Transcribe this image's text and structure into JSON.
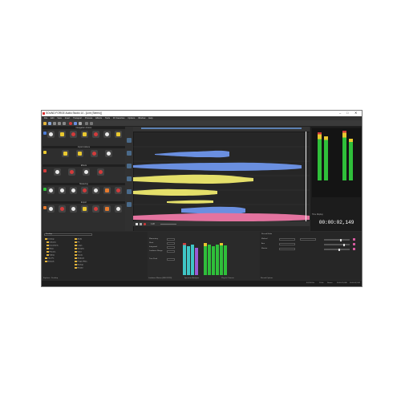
{
  "window": {
    "title": "SOUND FORGE Audio Studio 14 - [Live (Stereo)]",
    "controls": {
      "minimize": "–",
      "maximize": "□",
      "close": "✕"
    }
  },
  "menu": [
    "File",
    "Edit",
    "View",
    "Insert",
    "Transport",
    "Process",
    "Effects",
    "Tools",
    "FX Favorites",
    "Options",
    "Window",
    "Help"
  ],
  "left_panel": {
    "sections": [
      "Navigation Actions",
      "Import Actions",
      "Effects",
      "Mastering",
      "Export"
    ]
  },
  "transport": {
    "zoom": "1:28"
  },
  "right_panel": {
    "header": "Time Display",
    "timecode": "00:00:02,149"
  },
  "bottom": {
    "explorer": {
      "path": "Desktop",
      "tree": [
        "Desktop",
        "Libraries",
        "Documents",
        "Music",
        "Pictures",
        "Videos",
        "This PC",
        "Network"
      ],
      "files": [
        "Audio",
        "FX",
        "Loops",
        "Samples",
        "Voice",
        "Vocals",
        "Mixdown",
        "Project Files",
        "Backup",
        "Render"
      ],
      "tab_title": "Explorer - Desktop"
    },
    "loudness": {
      "labels": [
        "Momentary",
        "Short",
        "Integrated",
        "Loudness Range",
        "True Peak"
      ],
      "tabs": [
        "Loudness Meters (EBU R128)",
        "Spectrum Analyzer",
        "Plug-In Chooser"
      ]
    },
    "record": {
      "rows": [
        "Record Mode",
        "Method",
        "Arm",
        "Monitor"
      ],
      "tab_title": "Record Options"
    }
  },
  "status": {
    "left": "",
    "items": [
      "44,100 Hz",
      "16 bit",
      "Stereo",
      "00:00:20,000",
      "00:00:02,149"
    ]
  },
  "colors": {
    "wave_blue": "#6a8fe0",
    "wave_yellow": "#e4df6a",
    "wave_pink": "#e3739f",
    "accent_red": "#d23b3b",
    "meter_green": "#2fbf3a",
    "meter_cyan": "#3fc7c7"
  },
  "icons": [
    "app-icon",
    "folder-icon",
    "record-icon",
    "play-icon",
    "stop-icon",
    "effect-icon"
  ]
}
